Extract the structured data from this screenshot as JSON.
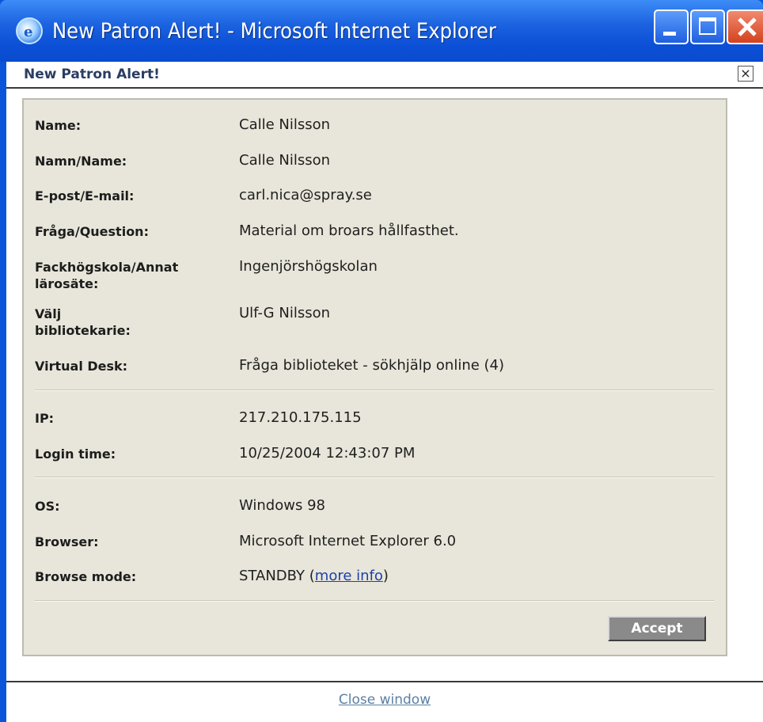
{
  "window": {
    "title": "New Patron Alert! - Microsoft Internet Explorer",
    "icon": "ie-icon",
    "controls": [
      "minimize-icon",
      "maximize-icon",
      "close-icon"
    ]
  },
  "header": {
    "title": "New Patron Alert!",
    "close_glyph": "×"
  },
  "patron": {
    "name_label": "Name:",
    "name_value": "Calle Nilsson",
    "namn_label": "Namn/Name:",
    "namn_value": "Calle Nilsson",
    "email_label": "E-post/E-mail:",
    "email_value": "carl.nica@spray.se",
    "question_label": "Fråga/Question:",
    "question_value": "Material om broars hållfasthet.",
    "school_label_1": "Fackhögskola/Annat",
    "school_label_2": "lärosäte:",
    "school_value": "Ingenjörshögskolan",
    "librarian_label_1": "Välj",
    "librarian_label_2": "bibliotekarie:",
    "librarian_value": "Ulf-G Nilsson",
    "desk_label": "Virtual Desk:",
    "desk_value": "Fråga biblioteket - sökhjälp online (4)"
  },
  "session": {
    "ip_label": "IP:",
    "ip_value": "217.210.175.115",
    "login_label": "Login time:",
    "login_value": "10/25/2004 12:43:07 PM"
  },
  "client": {
    "os_label": "OS:",
    "os_value": "Windows 98",
    "browser_label": "Browser:",
    "browser_value": "Microsoft Internet Explorer 6.0",
    "mode_label": "Browse mode:",
    "mode_value": "STANDBY",
    "mode_open_paren": "(",
    "mode_link": "more info",
    "mode_close_paren": ")"
  },
  "actions": {
    "accept_label": "Accept",
    "close_window_label": "Close window"
  },
  "colors": {
    "titlebar": "#0b4fd6",
    "panel_bg": "#e8e6da",
    "accept_bg": "#8a8a8a",
    "link": "#1f3fa8"
  }
}
